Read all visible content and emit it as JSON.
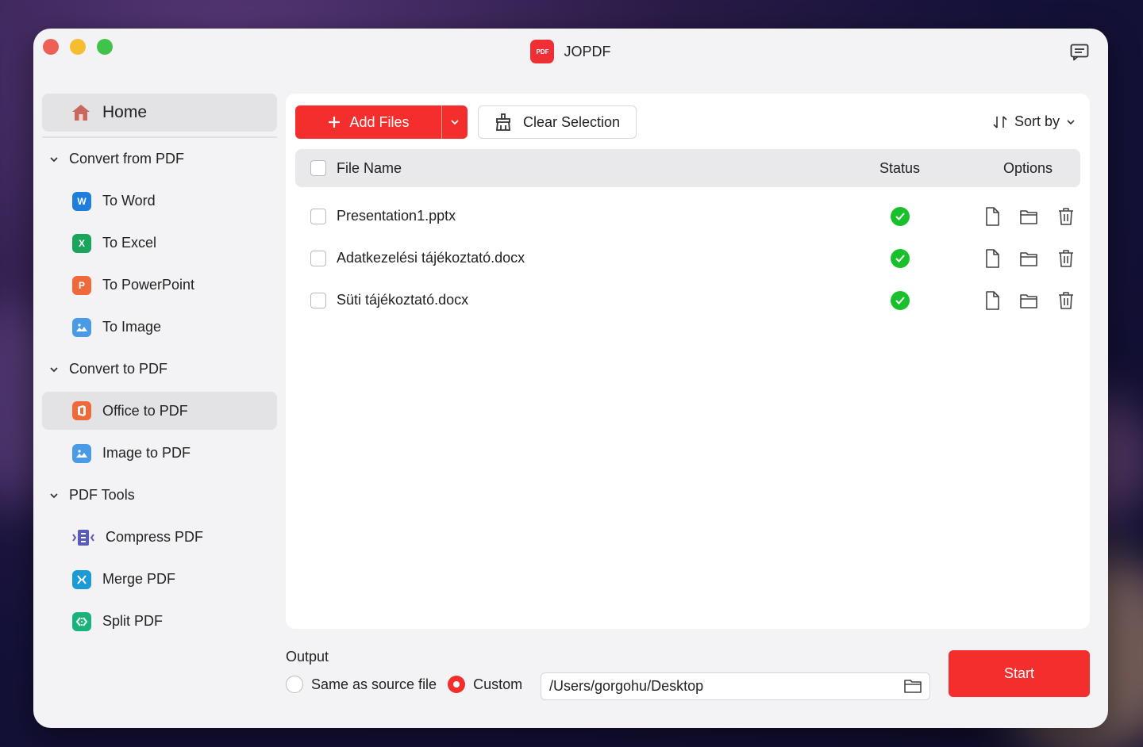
{
  "app": {
    "title": "JOPDF",
    "logo_text": "PDF"
  },
  "sidebar": {
    "home": "Home",
    "groups": [
      {
        "label": "Convert from PDF",
        "items": [
          "To Word",
          "To Excel",
          "To PowerPoint",
          "To Image"
        ]
      },
      {
        "label": "Convert to PDF",
        "items": [
          "Office to PDF",
          "Image to PDF"
        ]
      },
      {
        "label": "PDF Tools",
        "items": [
          "Compress PDF",
          "Merge PDF",
          "Split PDF"
        ]
      }
    ],
    "active_item": "Office to PDF",
    "icon_letters": {
      "word": "W",
      "excel": "X",
      "powerpoint": "P"
    }
  },
  "toolbar": {
    "add_files": "Add Files",
    "clear_selection": "Clear Selection",
    "sort_by": "Sort by"
  },
  "table": {
    "headers": {
      "name": "File Name",
      "status": "Status",
      "options": "Options"
    },
    "rows": [
      {
        "name": "Presentation1.pptx",
        "status": "done"
      },
      {
        "name": "Adatkezelési tájékoztató.docx",
        "status": "done"
      },
      {
        "name": "Süti tájékoztató.docx",
        "status": "done"
      }
    ]
  },
  "output": {
    "label": "Output",
    "same_as_source": "Same as source file",
    "custom": "Custom",
    "selected": "custom",
    "path": "/Users/gorgohu/Desktop"
  },
  "start_button": "Start",
  "colors": {
    "accent": "#f42d2d",
    "success": "#18c12c",
    "window_bg": "#f3f3f5"
  }
}
